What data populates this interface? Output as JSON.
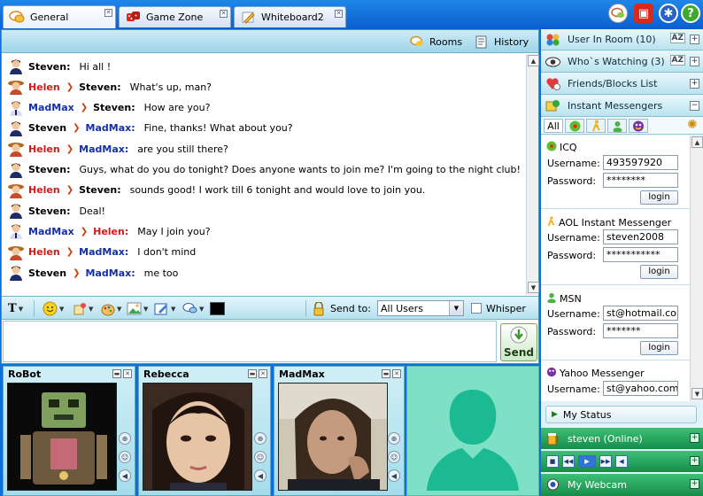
{
  "tabs": [
    {
      "label": "General",
      "icon": "chat-bubble-icon",
      "active": true
    },
    {
      "label": "Game Zone",
      "icon": "dice-icon",
      "active": false
    },
    {
      "label": "Whiteboard2",
      "icon": "pencil-icon",
      "active": false
    }
  ],
  "chat_toolbar": {
    "rooms_label": "Rooms",
    "history_label": "History"
  },
  "messages": [
    {
      "from": "Steven:",
      "to": "",
      "text": "Hi all !"
    },
    {
      "from": "Helen",
      "to": "Steven:",
      "text": "What's up, man?"
    },
    {
      "from": "MadMax",
      "to": "Steven:",
      "text": "How are you?"
    },
    {
      "from": "Steven",
      "to": "MadMax:",
      "text": "Fine, thanks! What about you?"
    },
    {
      "from": "Helen",
      "to": "MadMax:",
      "text": "are you still there?"
    },
    {
      "from": "Steven:",
      "to": "",
      "text": "Guys, what do you do tonight? Does anyone wants to join me? I'm going to the night club!"
    },
    {
      "from": "Helen",
      "to": "Steven:",
      "text": "sounds good! I work till 6 tonight and would love to join you."
    },
    {
      "from": "Steven:",
      "to": "",
      "text": "Deal!"
    },
    {
      "from": "MadMax",
      "to": "Helen:",
      "text": "May I join you?"
    },
    {
      "from": "Helen",
      "to": "MadMax:",
      "text": "I don't mind"
    },
    {
      "from": "Steven",
      "to": "MadMax:",
      "text": "me too"
    }
  ],
  "format_bar": {
    "send_to_label": "Send to:",
    "send_to_value": "All Users",
    "whisper_label": "Whisper"
  },
  "composer": {
    "send_label": "Send",
    "message_value": ""
  },
  "webcams": [
    {
      "name": "RoBot"
    },
    {
      "name": "Rebecca"
    },
    {
      "name": "MadMax"
    }
  ],
  "right_panel": {
    "user_in_room": "User In Room (10)",
    "whos_watching": "Who`s Watching (3)",
    "friends_blocks": "Friends/Blocks List",
    "instant_messengers": "Instant Messengers",
    "im_tab_all": "All",
    "sort_label": "AZ",
    "im_services": [
      {
        "name": "ICQ",
        "username_label": "Username:",
        "username": "493597920",
        "password_label": "Password:",
        "password": "********",
        "login_label": "login"
      },
      {
        "name": "AOL Instant Messenger",
        "username_label": "Username:",
        "username": "steven2008",
        "password_label": "Password:",
        "password": "***********",
        "login_label": "login"
      },
      {
        "name": "MSN",
        "username_label": "Username:",
        "username": "st@hotmail.com",
        "password_label": "Password:",
        "password": "*******",
        "login_label": "login"
      },
      {
        "name": "Yahoo Messenger",
        "username_label": "Username:",
        "username": "st@yahoo.com"
      }
    ],
    "my_status": "My Status",
    "online_user": "steven (Online)",
    "my_webcam": "My Webcam"
  },
  "colors": {
    "helen": "#d41a1a",
    "madmax": "#1430a8",
    "steven": "#000000",
    "accent_green": "#168d49",
    "title_blue": "#0a5fcf"
  }
}
